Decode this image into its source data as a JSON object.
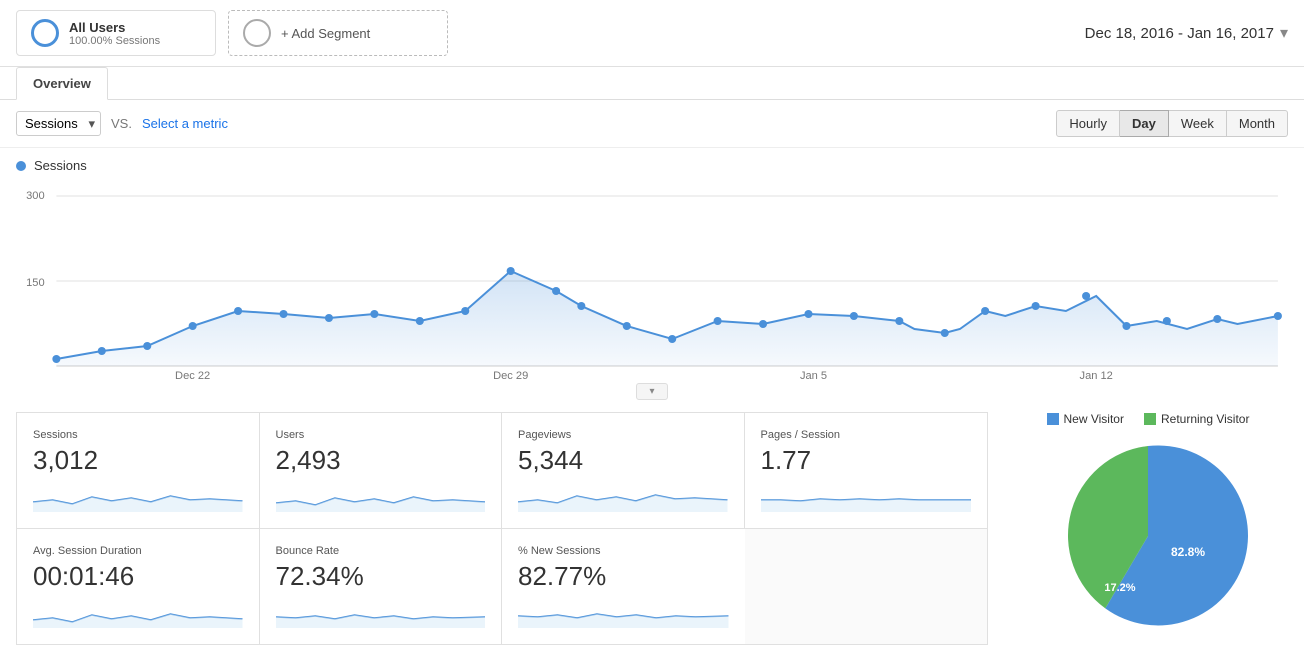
{
  "header": {
    "segment": {
      "title": "All Users",
      "subtitle": "100.00% Sessions"
    },
    "add_segment_label": "+ Add Segment",
    "date_range": "Dec 18, 2016 - Jan 16, 2017"
  },
  "tabs": [
    {
      "id": "overview",
      "label": "Overview",
      "active": true
    }
  ],
  "toolbar": {
    "metric_label": "Sessions",
    "vs_label": "VS.",
    "select_metric_label": "Select a metric",
    "time_buttons": [
      {
        "id": "hourly",
        "label": "Hourly"
      },
      {
        "id": "day",
        "label": "Day",
        "active": true
      },
      {
        "id": "week",
        "label": "Week"
      },
      {
        "id": "month",
        "label": "Month"
      }
    ]
  },
  "chart": {
    "legend_label": "Sessions",
    "y_labels": [
      "300",
      "150"
    ],
    "x_labels": [
      "Dec 22",
      "Dec 29",
      "Jan 5",
      "Jan 12"
    ]
  },
  "stats": [
    {
      "label": "Sessions",
      "value": "3,012"
    },
    {
      "label": "Users",
      "value": "2,493"
    },
    {
      "label": "Pageviews",
      "value": "5,344"
    },
    {
      "label": "Pages / Session",
      "value": "1.77"
    },
    {
      "label": "Avg. Session Duration",
      "value": "00:01:46"
    },
    {
      "label": "Bounce Rate",
      "value": "72.34%"
    },
    {
      "label": "% New Sessions",
      "value": "82.77%"
    }
  ],
  "pie_chart": {
    "new_visitor_label": "New Visitor",
    "returning_visitor_label": "Returning Visitor",
    "new_visitor_pct": 82.8,
    "returning_visitor_pct": 17.2,
    "new_visitor_pct_label": "82.8%",
    "returning_visitor_pct_label": "17.2%",
    "new_visitor_color": "#4a90d9",
    "returning_visitor_color": "#5cb85c"
  }
}
